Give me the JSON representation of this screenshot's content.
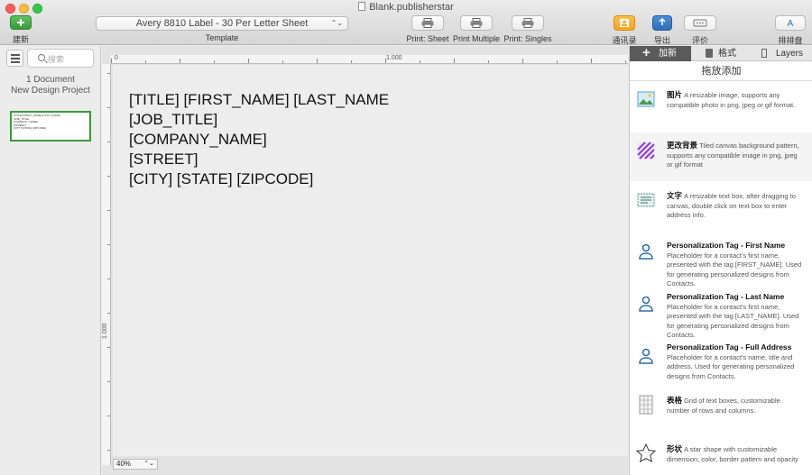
{
  "window": {
    "title": "Blank.publisherstar"
  },
  "toolbar": {
    "new_label": "建新",
    "template_value": "Avery 8810 Label - 30 Per Letter Sheet",
    "template_label": "Template",
    "print_sheet": "Print: Sheet",
    "print_multiple": "Print Multiple",
    "print_singles": "Print: Singles",
    "contacts": "通讯录",
    "export": "导出",
    "review": "评价",
    "fonts": "排排盘"
  },
  "sidebar": {
    "search_placeholder": "搜索",
    "doc_count": "1 Document",
    "project_name": "New Design Project",
    "thumb_lines": [
      "[TITLE] [FIRST_NAME] [LAST_NAME]",
      "[JOB_TITLE]",
      "[COMPANY_NAME]",
      "[STREET]",
      "[CITY] [STATE] [ZIPCODE]"
    ]
  },
  "canvas": {
    "lines": [
      "[TITLE] [FIRST_NAME] [LAST_NAME",
      "[JOB_TITLE]",
      "[COMPANY_NAME]",
      "[STREET]",
      "[CITY] [STATE] [ZIPCODE]"
    ],
    "ruler_top": [
      "0",
      "1.000"
    ],
    "ruler_left": [
      "1.000"
    ],
    "zoom": "40%"
  },
  "panel": {
    "tabs": {
      "add": "加新",
      "format": "格式",
      "layers": "Layers"
    },
    "drag_title": "拖放添加",
    "items": [
      {
        "icon": "image-icon",
        "title": "图片",
        "desc": " A resizable image, supports any compatible photo in png, jpeg or gif format."
      },
      {
        "icon": "pattern-icon",
        "title": "更改背景",
        "desc": " Tiled canvas background pattern, supports any compatible image in png, jpeg or gif format"
      },
      {
        "icon": "text-box-icon",
        "title": "文字",
        "desc": " A resizable text box, after dragging to canvas, double click on text box to enter address info."
      },
      {
        "icon": "person-icon",
        "title": "Personalization Tag - First Name",
        "desc": "Placeholder for a contact's first name, presented with the tag [FIRST_NAME]. Used for generating personalized designs from Contacts."
      },
      {
        "icon": "person-icon",
        "title": "Personalization Tag - Last Name",
        "desc": "Placeholder for a contact's first name, presented with the tag [LAST_NAME]. Used for generating personalized designs from Contacts."
      },
      {
        "icon": "person-icon",
        "title": "Personalization Tag - Full Address",
        "desc": "Placeholder for a contact's name, title and address. Used for generating personalized designs from Contacts."
      },
      {
        "icon": "grid-icon",
        "title": "表格",
        "desc": " Grid of text boxes, customizable number of rows and columns."
      },
      {
        "icon": "star-icon",
        "title": "形状",
        "desc": " A star shape with customizable dimension, color, border pattern and opacity"
      }
    ]
  },
  "colors": {
    "accent_green": "#3a9a3a",
    "icon_blue": "#2f6eb5",
    "pattern_purple": "#8a3fcf",
    "export_orange": "#f5a623"
  }
}
